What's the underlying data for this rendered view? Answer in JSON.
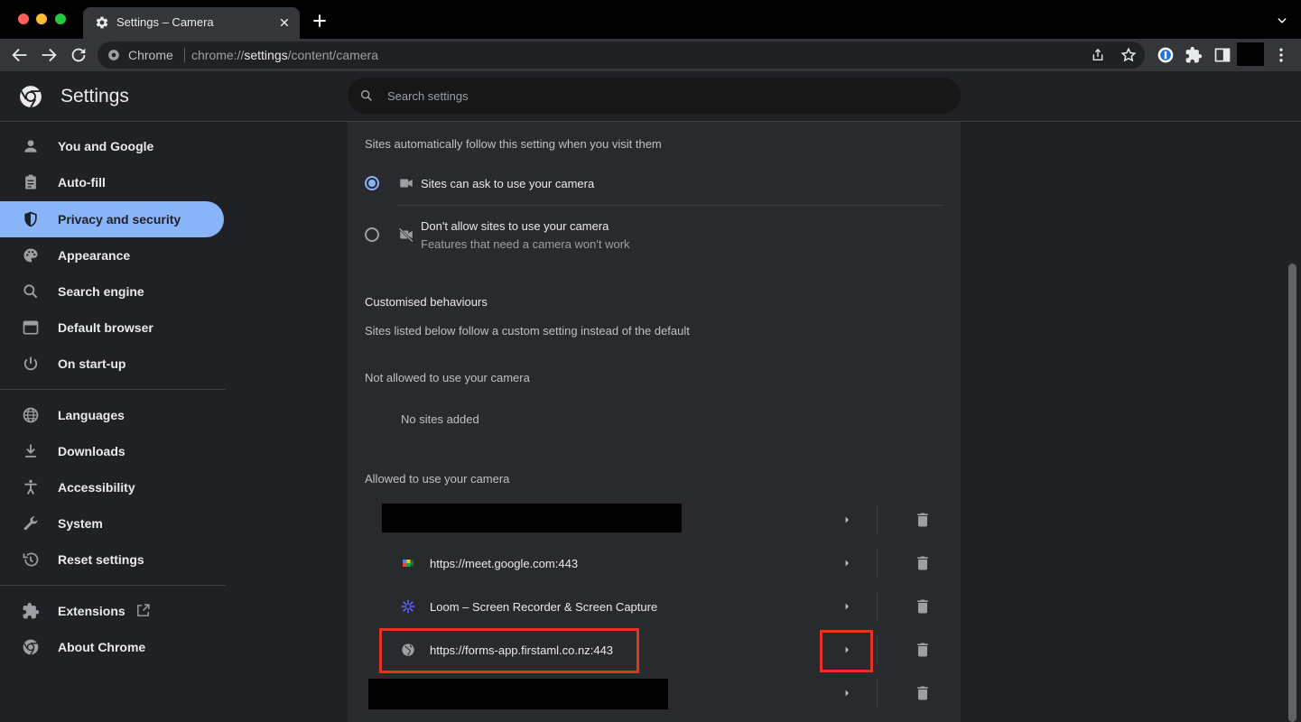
{
  "window": {
    "tab_title": "Settings – Camera",
    "tab_icon": "gear-icon"
  },
  "toolbar": {
    "omnibox_chip": "Chrome",
    "url_prefix": "chrome://",
    "url_host": "settings",
    "url_path": "/content/camera"
  },
  "header": {
    "title": "Settings",
    "search_placeholder": "Search settings"
  },
  "sidebar": {
    "items": [
      {
        "label": "You and Google",
        "icon": "person-icon",
        "active": false
      },
      {
        "label": "Auto-fill",
        "icon": "clipboard-icon",
        "active": false
      },
      {
        "label": "Privacy and security",
        "icon": "shield-icon",
        "active": true
      },
      {
        "label": "Appearance",
        "icon": "palette-icon",
        "active": false
      },
      {
        "label": "Search engine",
        "icon": "search-icon",
        "active": false
      },
      {
        "label": "Default browser",
        "icon": "browser-icon",
        "active": false
      },
      {
        "label": "On start-up",
        "icon": "power-icon",
        "active": false
      },
      {
        "label": "Languages",
        "icon": "globe-icon",
        "active": false
      },
      {
        "label": "Downloads",
        "icon": "download-icon",
        "active": false
      },
      {
        "label": "Accessibility",
        "icon": "accessibility-icon",
        "active": false
      },
      {
        "label": "System",
        "icon": "wrench-icon",
        "active": false
      },
      {
        "label": "Reset settings",
        "icon": "restore-icon",
        "active": false
      },
      {
        "label": "Extensions",
        "icon": "puzzle-icon",
        "active": false
      },
      {
        "label": "About Chrome",
        "icon": "chrome-icon",
        "active": false
      }
    ]
  },
  "camera": {
    "default_intro": "Sites automatically follow this setting when you visit them",
    "option_allow": "Sites can ask to use your camera",
    "option_block": "Don't allow sites to use your camera",
    "option_block_sub": "Features that need a camera won't work",
    "selected_option": "allow",
    "custom_heading": "Customised behaviours",
    "custom_intro": "Sites listed below follow a custom setting instead of the default",
    "blocked_heading": "Not allowed to use your camera",
    "blocked_empty": "No sites added",
    "allowed_heading": "Allowed to use your camera",
    "allowed_sites": [
      {
        "label": "",
        "redacted": true
      },
      {
        "label": "https://meet.google.com:443",
        "icon": "google-meet-icon"
      },
      {
        "label": "Loom – Screen Recorder & Screen Capture",
        "icon": "loom-icon"
      },
      {
        "label": "https://forms-app.firstaml.co.nz:443",
        "icon": "globe-icon",
        "highlighted": true
      },
      {
        "label": "",
        "redacted": true
      }
    ]
  },
  "colors": {
    "accent": "#8ab4f8",
    "highlight_box": "#e53222",
    "background": "#202124",
    "card": "#292a2d"
  }
}
